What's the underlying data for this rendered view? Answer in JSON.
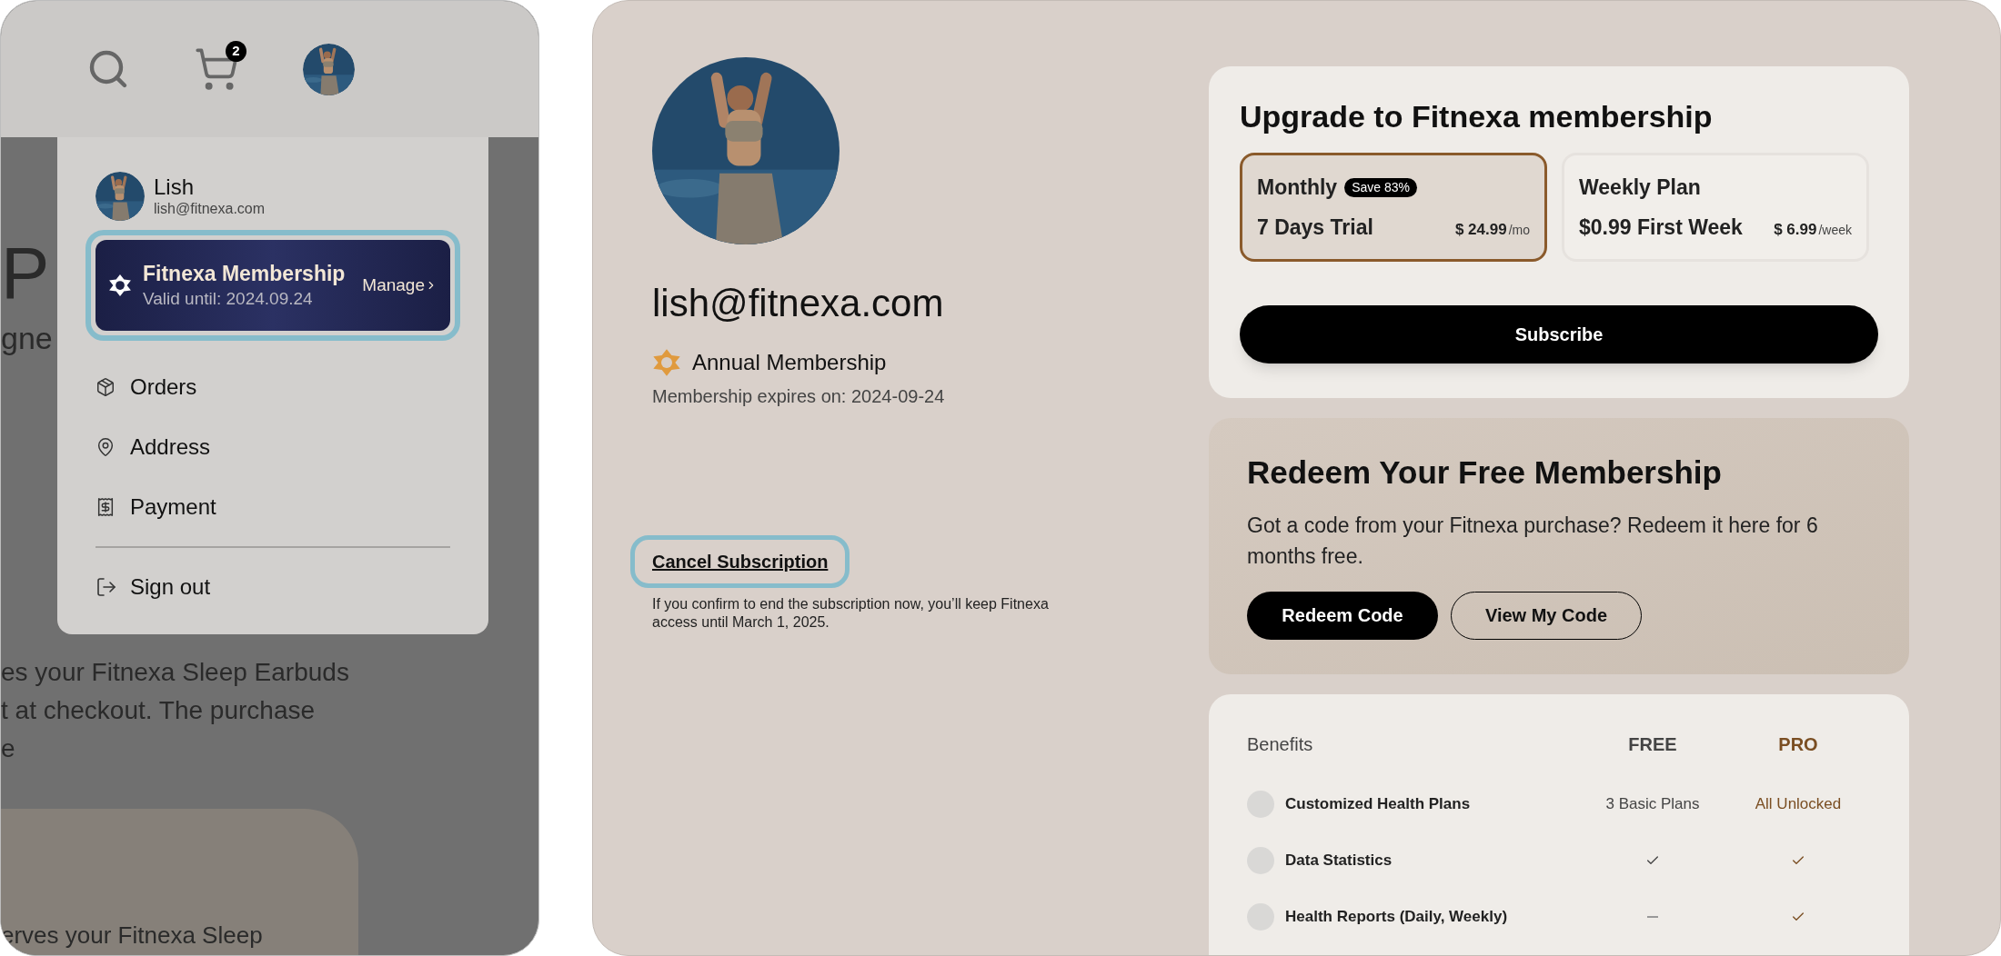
{
  "shop_panel": {
    "cart_count": "2",
    "background_text": {
      "heading": "P",
      "subheading": "gne",
      "paragraph": [
        "es your Fitnexa Sleep Earbuds",
        "t at checkout. The purchase",
        "e"
      ],
      "card_text": "erves your Fitnexa Sleep"
    },
    "account_menu": {
      "name": "Lish",
      "email": "lish@fitnexa.com",
      "membership": {
        "title": "Fitnexa Membership",
        "valid_until": "Valid until: 2024.09.24",
        "action": "Manage"
      },
      "items": [
        {
          "label": "Orders",
          "kind": "orders"
        },
        {
          "label": "Address",
          "kind": "address"
        },
        {
          "label": "Payment",
          "kind": "payment"
        }
      ],
      "sign_out": "Sign out"
    }
  },
  "profile": {
    "email": "lish@fitnexa.com",
    "membership": "Annual Membership",
    "expires": "Membership expires on: 2024-09-24",
    "cancel": "Cancel Subscription",
    "cancel_note": "If you confirm to end the subscription now, you’ll keep Fitnexa access until March 1, 2025."
  },
  "upgrade": {
    "title": "Upgrade to Fitnexa membership",
    "plans": [
      {
        "name": "Monthly",
        "badge": "Save 83%",
        "offer": "7 Days Trial",
        "price": "$ 24.99",
        "unit": "/mo",
        "selected": true
      },
      {
        "name": "Weekly Plan",
        "offer": "$0.99 First Week",
        "price": "$ 6.99",
        "unit": "/week",
        "selected": false
      }
    ],
    "button": "Subscribe"
  },
  "redeem": {
    "title": "Redeem Your Free Membership",
    "text": "Got a code from your Fitnexa purchase? Redeem it here for 6 months free.",
    "primary": "Redeem Code",
    "secondary": "View My Code"
  },
  "benefits": {
    "columns": [
      "Benefits",
      "FREE",
      "PRO"
    ],
    "rows": [
      {
        "name": "Customized Health Plans",
        "free": {
          "kind": "text",
          "text": "3 Basic Plans"
        },
        "pro": {
          "kind": "text",
          "text": "All Unlocked"
        }
      },
      {
        "name": "Data Statistics",
        "free": {
          "kind": "check"
        },
        "pro": {
          "kind": "check"
        }
      },
      {
        "name": "Health Reports (Daily, Weekly)",
        "free": {
          "kind": "dash"
        },
        "pro": {
          "kind": "check"
        }
      }
    ]
  }
}
